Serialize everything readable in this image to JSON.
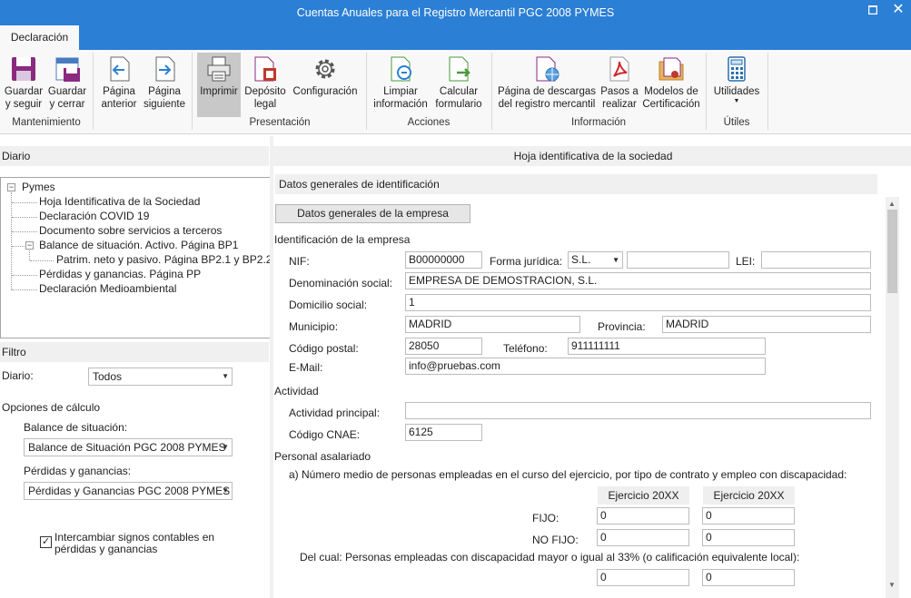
{
  "window": {
    "title": "Cuentas Anuales para el Registro Mercantil PGC 2008 PYMES",
    "maximize_icon": "maximize-icon",
    "close_icon": "close-icon"
  },
  "ribbon": {
    "tab": "Declaración",
    "buttons": {
      "guardar_seguir": "Guardar\ny seguir",
      "guardar_cerrar": "Guardar\ny cerrar",
      "pagina_anterior": "Página\nanterior",
      "pagina_siguiente": "Página\nsiguiente",
      "imprimir": "Imprimir",
      "deposito_legal": "Depósito\nlegal",
      "configuracion": "Configuración",
      "limpiar": "Limpiar\ninformación",
      "calcular": "Calcular\nformulario",
      "descargas": "Página de descargas\ndel registro mercantil",
      "pasos": "Pasos a\nrealizar",
      "modelos": "Modelos de\nCertificación",
      "utilidades": "Utilidades"
    },
    "groups": {
      "mantenimiento": "Mantenimiento",
      "presentacion": "Presentación",
      "acciones": "Acciones",
      "informacion": "Información",
      "utiles": "Útiles"
    }
  },
  "left": {
    "diario_header": "Diario",
    "tree": {
      "root": "Pymes",
      "items": [
        "Hoja Identificativa de la Sociedad",
        "Declaración COVID 19",
        "Documento sobre servicios a terceros",
        "Balance de situación. Activo. Página BP1",
        "Patrim. neto y pasivo. Página BP2.1 y BP2.2",
        "Pérdidas y ganancias. Página PP",
        "Declaración Medioambiental"
      ]
    },
    "filtro_header": "Filtro",
    "diario_label": "Diario:",
    "diario_value": "Todos",
    "opciones_label": "Opciones de cálculo",
    "balance_label": "Balance de situación:",
    "balance_value": "Balance de Situación PGC 2008 PYMES",
    "perdidas_label": "Pérdidas y ganancias:",
    "perdidas_value": "Pérdidas y Ganancias PGC 2008 PYMES",
    "checkbox_label": "Intercambiar signos contables en\npérdidas y ganancias",
    "checkbox_checked": true
  },
  "main": {
    "header": "Hoja identificativa de la sociedad",
    "section": "Datos generales de identificación",
    "empresa_button": "Datos generales de la empresa",
    "identificacion": "Identificación de la empresa",
    "nif_label": "NIF:",
    "nif": "B00000000",
    "forma_label": "Forma jurídica:",
    "forma": "S.L.",
    "lei_label": "LEI:",
    "lei": "",
    "denominacion_label": "Denominación social:",
    "denominacion": "EMPRESA DE DEMOSTRACION, S.L.",
    "domicilio_label": "Domicilio social:",
    "domicilio": "1",
    "municipio_label": "Municipio:",
    "municipio": "MADRID",
    "provincia_label": "Provincia:",
    "provincia": "MADRID",
    "cp_label": "Código postal:",
    "cp": "28050",
    "telefono_label": "Teléfono:",
    "telefono": "911111111",
    "email_label": "E-Mail:",
    "email": "info@pruebas.com",
    "actividad": "Actividad",
    "actividad_principal_label": "Actividad principal:",
    "actividad_principal": "",
    "cnae_label": "Código CNAE:",
    "cnae": "6125",
    "personal": "Personal asalariado",
    "personal_a": "a) Número medio de personas empleadas en el curso del ejercicio, por tipo de contrato y empleo con discapacidad:",
    "ejercicio1": "Ejercicio 20XX",
    "ejercicio2": "Ejercicio 20XX",
    "fijo_label": "FIJO:",
    "fijo1": "0",
    "fijo2": "0",
    "nofijo_label": "NO FIJO:",
    "nofijo1": "0",
    "nofijo2": "0",
    "discapacidad": "Del cual: Personas empleadas con discapacidad mayor o igual al 33% (o calificación equivalente local):",
    "disc1": "0",
    "disc2": "0"
  }
}
